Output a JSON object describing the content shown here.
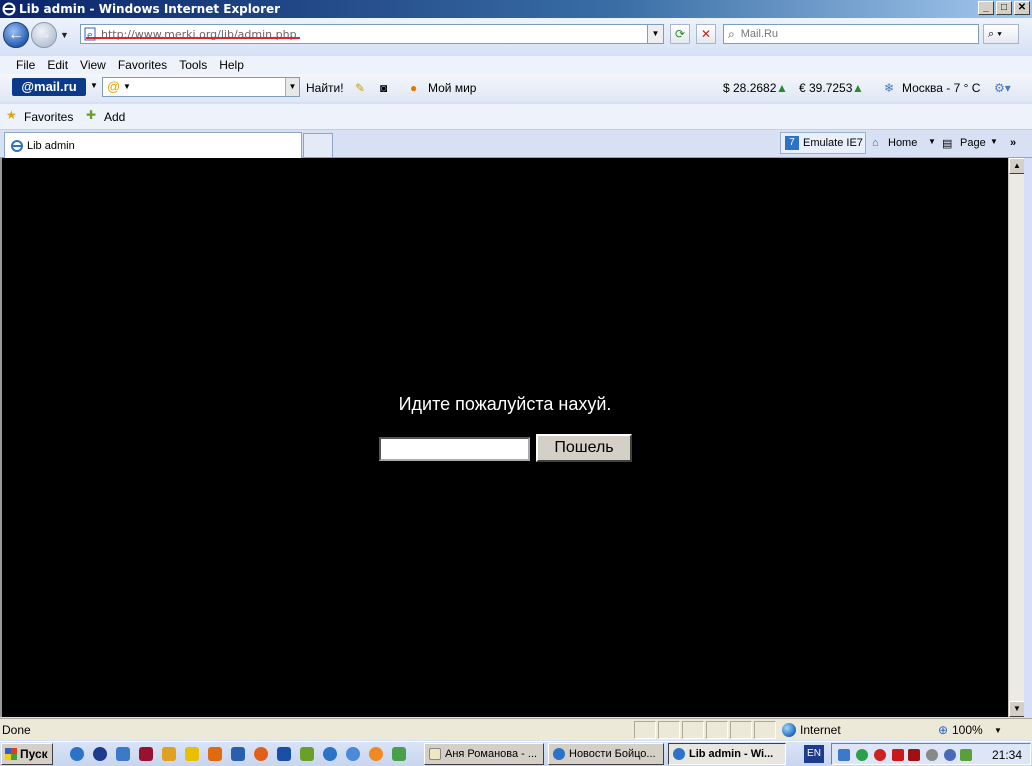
{
  "window": {
    "title": "Lib admin - Windows Internet Explorer",
    "buttons": [
      "_",
      "□",
      "✕"
    ]
  },
  "address_bar": {
    "url": "http://www.merki.org/lib/admin.php",
    "search_placeholder": "Mail.Ru"
  },
  "menu": {
    "items": [
      "File",
      "Edit",
      "View",
      "Favorites",
      "Tools",
      "Help"
    ]
  },
  "mailru_toolbar": {
    "logo": "@mail.ru",
    "find_label": "Найти!",
    "my_world_label": "Мой мир",
    "usd_rate": "$ 28.2682",
    "eur_rate": "€ 39.7253",
    "weather": "Москва - 7 ° С"
  },
  "favorites_bar": {
    "favorites_label": "Favorites",
    "add_label": "Add"
  },
  "tabs": {
    "active_tab_label": "Lib admin",
    "emulate_label": "Emulate IE7",
    "home_label": "Home",
    "page_label": "Page"
  },
  "page": {
    "message": "Идите пожалуйста нахуй.",
    "submit_label": "Пошель",
    "input_value": ""
  },
  "status_bar": {
    "status": "Done",
    "zone": "Internet",
    "zoom": "100%"
  },
  "taskbar": {
    "start_label": "Пуск",
    "tasks": [
      "Аня Романова - ...",
      "Новости Бойцо...",
      "Lib admin - Wi..."
    ],
    "language": "EN",
    "clock": "21:34"
  }
}
